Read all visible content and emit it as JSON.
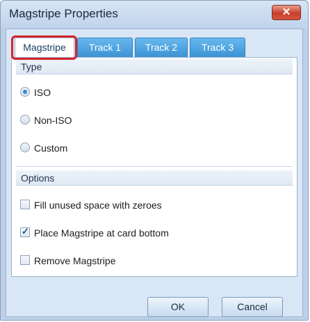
{
  "window": {
    "title": "Magstripe Properties",
    "close_label": "✕"
  },
  "tabs": [
    {
      "label": "Magstripe",
      "active": true
    },
    {
      "label": "Track 1",
      "active": false
    },
    {
      "label": "Track 2",
      "active": false
    },
    {
      "label": "Track 3",
      "active": false
    }
  ],
  "type_section": {
    "header": "Type",
    "options": [
      {
        "label": "ISO",
        "selected": true
      },
      {
        "label": "Non-ISO",
        "selected": false
      },
      {
        "label": "Custom",
        "selected": false
      }
    ]
  },
  "options_section": {
    "header": "Options",
    "checkboxes": [
      {
        "label": "Fill unused space with zeroes",
        "checked": false
      },
      {
        "label": "Place Magstripe at card bottom",
        "checked": true
      },
      {
        "label": "Remove Magstripe",
        "checked": false
      }
    ]
  },
  "buttons": {
    "ok_label": "OK",
    "cancel_label": "Cancel"
  },
  "colors": {
    "highlight": "#d4232b",
    "tab_inactive": "#4aa3e0",
    "close_button": "#c5402a"
  }
}
